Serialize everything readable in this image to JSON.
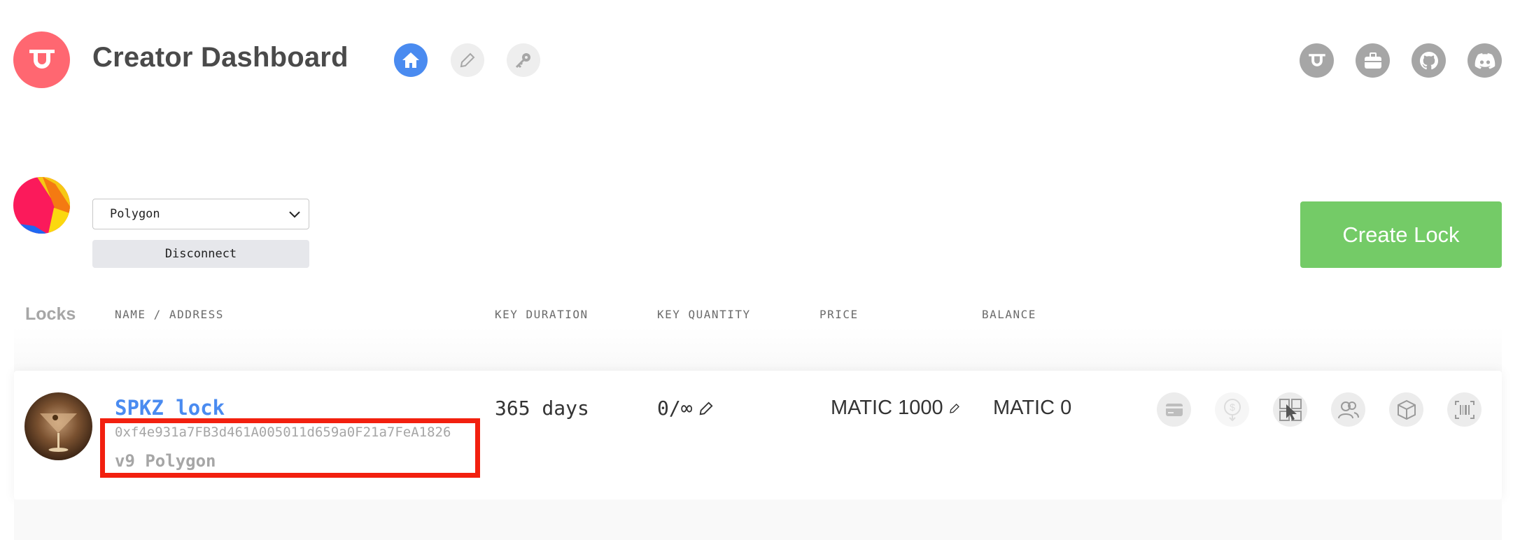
{
  "header": {
    "title": "Creator Dashboard",
    "nav": [
      {
        "name": "home",
        "icon": "home-icon",
        "active": true
      },
      {
        "name": "edit",
        "icon": "pencil-icon",
        "active": false
      },
      {
        "name": "keys",
        "icon": "key-icon",
        "active": false
      }
    ],
    "external_links": [
      "unlock-icon",
      "briefcase-icon",
      "github-icon",
      "discord-icon"
    ]
  },
  "account": {
    "network": "Polygon",
    "disconnect_label": "Disconnect",
    "create_lock_label": "Create Lock"
  },
  "table": {
    "section_label": "Locks",
    "columns": [
      "NAME / ADDRESS",
      "KEY DURATION",
      "KEY QUANTITY",
      "PRICE",
      "BALANCE"
    ]
  },
  "lock": {
    "name": "SPKZ lock",
    "address": "0xf4e931a7FB3d461A005011d659a0F21a7FeA1826",
    "version": "v9 Polygon",
    "key_duration": "365 days",
    "key_quantity": "0/∞",
    "price_currency": "MATIC",
    "price_value": "1000",
    "balance_currency": "MATIC",
    "balance_value": "0",
    "actions": [
      "credit-card-icon",
      "withdraw-icon",
      "embed-icon",
      "members-icon",
      "integrations-icon",
      "barcode-icon"
    ]
  },
  "colors": {
    "brand": "#ff6771",
    "accent_blue": "#4a8bf0",
    "create_green": "#74cb67",
    "highlight_red": "#f2200f"
  }
}
